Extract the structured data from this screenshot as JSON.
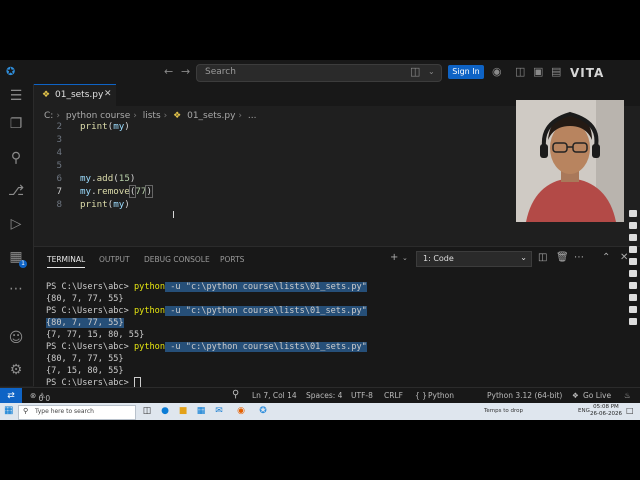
{
  "titlebar": {
    "search_placeholder": "Search",
    "signin_label": "Sign In",
    "brand": "VITA"
  },
  "editor": {
    "tab_label": "01_sets.py",
    "breadcrumb": [
      "C:",
      "python course",
      "lists",
      "01_sets.py",
      "..."
    ],
    "lines": [
      {
        "num": "2",
        "text": "print(my)"
      },
      {
        "num": "3",
        "text": ""
      },
      {
        "num": "4",
        "text": ""
      },
      {
        "num": "5",
        "text": ""
      },
      {
        "num": "6",
        "text": "my.add(15)"
      },
      {
        "num": "7",
        "text": "my.remove(77)"
      },
      {
        "num": "8",
        "text": "print(my)"
      }
    ]
  },
  "panel": {
    "tabs": [
      "TERMINAL",
      "OUTPUT",
      "DEBUG CONSOLE",
      "PORTS"
    ],
    "terminal_select": "1: Code",
    "prompt": "PS C:\\Users\\abc>",
    "command": "python",
    "flag": "-u",
    "script_path": "\"c:\\python course\\lists\\01_sets.py\"",
    "output": [
      "{80, 7, 77, 55}",
      "{80, 7, 77, 55}",
      "{7, 77, 15, 80, 55}",
      "{80, 7, 77, 55}",
      "{7, 15, 80, 55}"
    ]
  },
  "statusbar": {
    "problems": "0",
    "warnings": "0",
    "position": "Ln 7, Col 14",
    "spaces": "Spaces: 4",
    "encoding": "UTF-8",
    "eol": "CRLF",
    "language": "Python",
    "interpreter": "Python 3.12 (64-bit)",
    "golive": "Go Live"
  },
  "taskbar": {
    "search_placeholder": "Type here to search",
    "temp": "Temps to drop",
    "lang": "ENG",
    "time": "05:08 PM",
    "date": "26-06-2026"
  },
  "colors": {
    "accent": "#0e63c5",
    "editor_bg": "#1f1f1f",
    "terminal_highlight": "#264f78"
  }
}
